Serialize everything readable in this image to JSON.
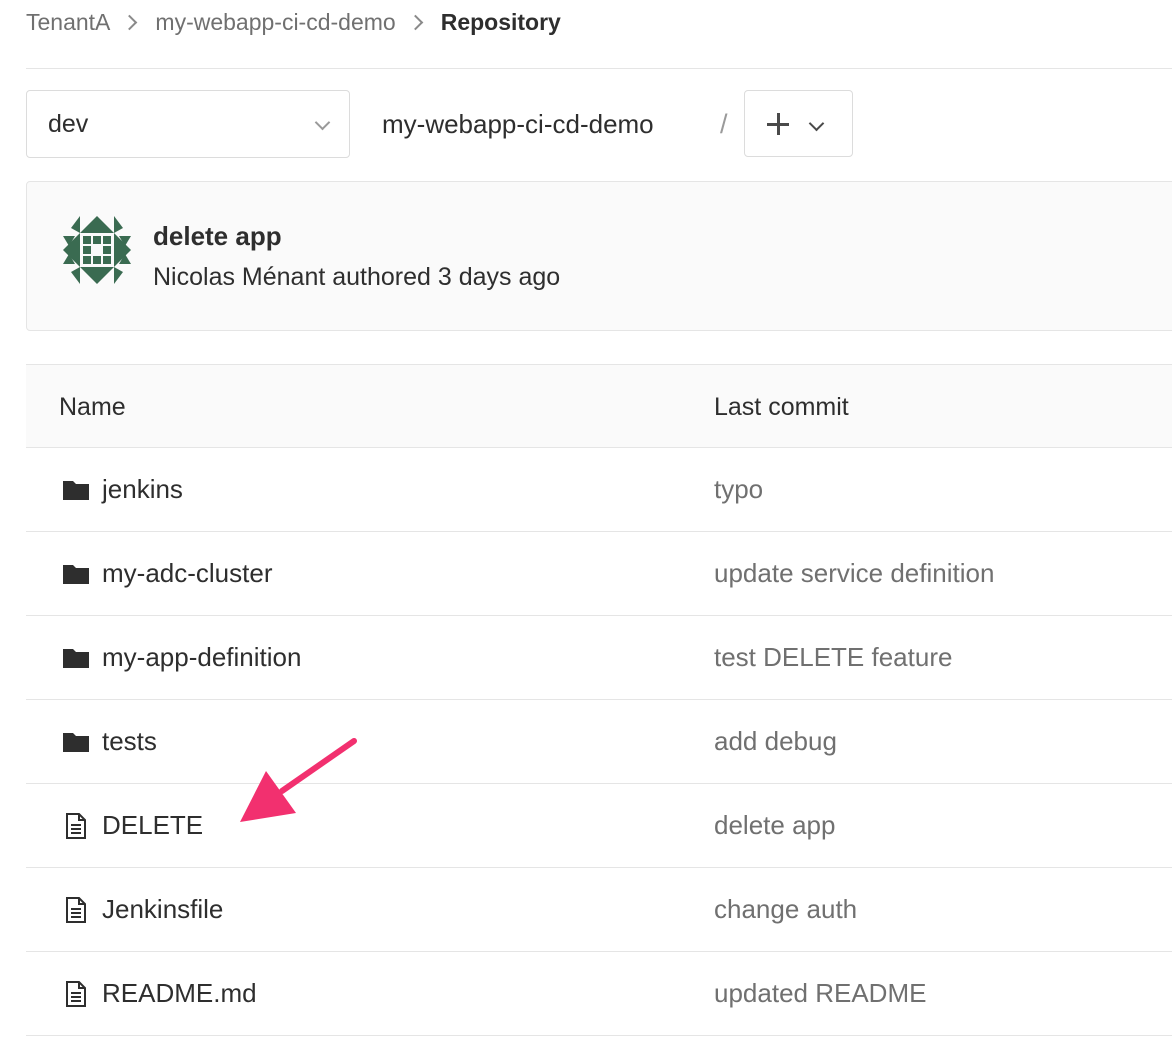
{
  "breadcrumb": {
    "items": [
      "TenantA",
      "my-webapp-ci-cd-demo"
    ],
    "current": "Repository"
  },
  "toolbar": {
    "branch": "dev",
    "repo_path": "my-webapp-ci-cd-demo",
    "separator": "/",
    "add_icon": "plus-icon",
    "dropdown_icon": "chevron-down-icon"
  },
  "last_commit": {
    "title": "delete app",
    "author_line": "Nicolas Ménant authored 3 days ago",
    "avatar": "identicon"
  },
  "table": {
    "headers": {
      "name": "Name",
      "last_commit": "Last commit"
    },
    "rows": [
      {
        "type": "folder",
        "name": "jenkins",
        "commit": "typo"
      },
      {
        "type": "folder",
        "name": "my-adc-cluster",
        "commit": "update service definition"
      },
      {
        "type": "folder",
        "name": "my-app-definition",
        "commit": "test DELETE feature"
      },
      {
        "type": "folder",
        "name": "tests",
        "commit": "add debug"
      },
      {
        "type": "file",
        "name": "DELETE",
        "commit": "delete app"
      },
      {
        "type": "file",
        "name": "Jenkinsfile",
        "commit": "change auth"
      },
      {
        "type": "file",
        "name": "README.md",
        "commit": "updated README"
      }
    ]
  },
  "annotation": {
    "type": "arrow",
    "color": "#f2306f",
    "points_to": "DELETE"
  },
  "colors": {
    "text_primary": "#2e2e2e",
    "text_secondary": "#707070",
    "border": "#e5e5e5",
    "panel_bg": "#fafafa",
    "avatar_green": "#3a6b51"
  }
}
